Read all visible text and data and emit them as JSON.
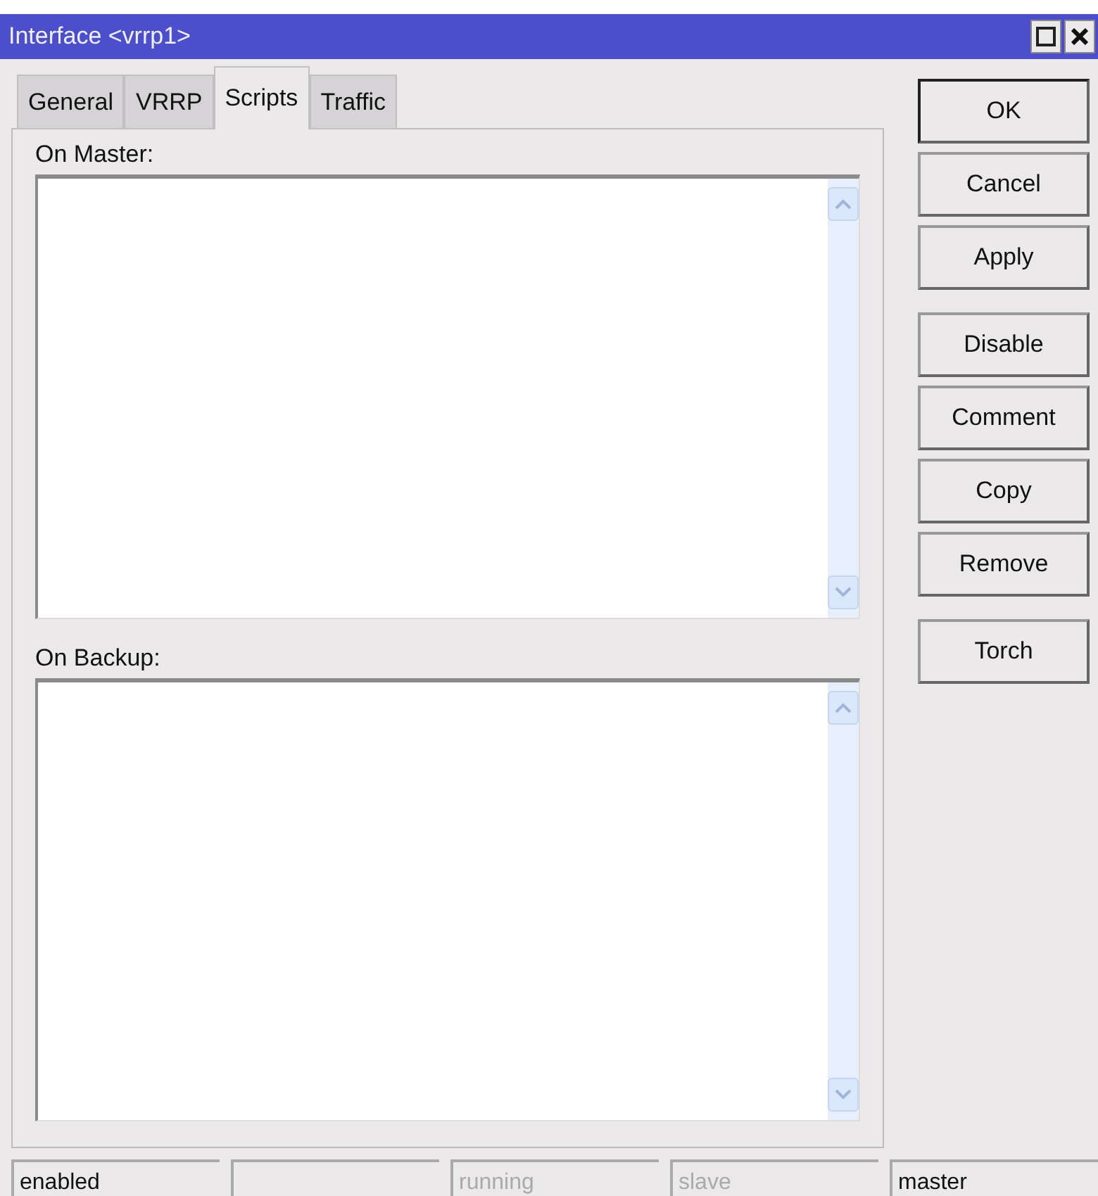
{
  "window": {
    "title": "Interface <vrrp1>"
  },
  "tabs": [
    {
      "label": "General",
      "selected": false
    },
    {
      "label": "VRRP",
      "selected": false
    },
    {
      "label": "Scripts",
      "selected": true
    },
    {
      "label": "Traffic",
      "selected": false
    }
  ],
  "fields": [
    {
      "label": "On Master:"
    },
    {
      "label": "On Backup:"
    }
  ],
  "button_groups": [
    [
      {
        "label": "OK",
        "default": true
      },
      {
        "label": "Cancel",
        "default": false
      },
      {
        "label": "Apply",
        "default": false
      }
    ],
    [
      {
        "label": "Disable",
        "default": false
      },
      {
        "label": "Comment",
        "default": false
      },
      {
        "label": "Copy",
        "default": false
      },
      {
        "label": "Remove",
        "default": false
      }
    ],
    [
      {
        "label": "Torch",
        "default": false
      }
    ]
  ],
  "status_bar": [
    {
      "kind": "text",
      "text": "enabled",
      "disabled": false
    },
    {
      "kind": "empty"
    },
    {
      "kind": "text",
      "text": "running",
      "disabled": true
    },
    {
      "kind": "text",
      "text": "slave",
      "disabled": true
    },
    {
      "kind": "text",
      "text": "master",
      "disabled": false
    }
  ]
}
